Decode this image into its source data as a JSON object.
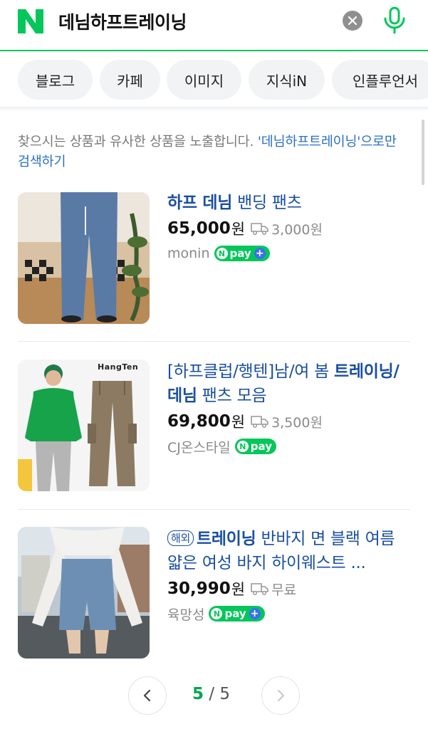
{
  "search": {
    "query": "데님하프트레이닝"
  },
  "tabs": [
    {
      "label": "블로그"
    },
    {
      "label": "카페"
    },
    {
      "label": "이미지"
    },
    {
      "label": "지식iN"
    },
    {
      "label": "인플루언서"
    }
  ],
  "notice": {
    "text": "찾으시는 상품과 유사한 상품을 노출합니다. ",
    "link": "'데님하프트레이닝'으로만 검색하기"
  },
  "products": [
    {
      "title_hl_1": "하프 데님",
      "title_rest": " 밴딩 팬츠",
      "price": "65,000",
      "currency": "원",
      "shipping": "3,000원",
      "seller": "monin",
      "pay_label": "pay",
      "pay_plus": true
    },
    {
      "title_pre": "[하프클럽/행텐]남/여 봄 ",
      "title_hl_1": "트레이닝/데님",
      "title_rest": " 팬츠 모음",
      "price": "69,800",
      "currency": "원",
      "shipping": "3,500원",
      "seller": "CJ온스타일",
      "pay_label": "pay",
      "pay_plus": false,
      "brand_mark": "HangTen"
    },
    {
      "badge": "해외",
      "title_hl_1": "트레이닝",
      "title_rest": " 반바지 면 블랙 여름 얇은 여성 바지 하이웨스트 ...",
      "price": "30,990",
      "currency": "원",
      "shipping": "무료",
      "seller": "육망성",
      "pay_label": "pay",
      "pay_plus": true
    }
  ],
  "pagination": {
    "current": "5",
    "separator": " / ",
    "total": "5"
  },
  "colors": {
    "brand_green": "#03c75a",
    "link_blue": "#1a4fa0"
  }
}
